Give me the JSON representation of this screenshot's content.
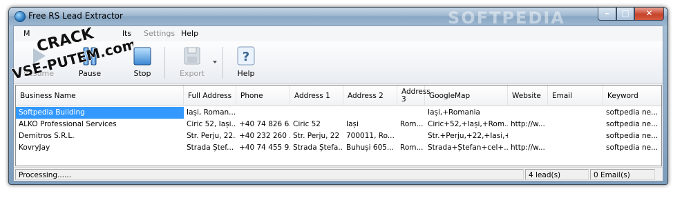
{
  "window": {
    "title": "Free RS Lead Extractor",
    "watermark": "SOFTPEDIA",
    "controls": {
      "minimize": "–",
      "maximize": "□",
      "close": "✕"
    }
  },
  "menu": {
    "items": [
      {
        "label": "M",
        "disabled": false
      },
      {
        "label": "lts",
        "disabled": false
      },
      {
        "label": "Settings",
        "disabled": true
      },
      {
        "label": "Help",
        "disabled": false
      }
    ]
  },
  "toolbar": {
    "resume": "Resume",
    "pause": "Pause",
    "stop": "Stop",
    "export": "Export",
    "help": "Help"
  },
  "grid": {
    "columns": [
      "Business Name",
      "Full Address",
      "Phone",
      "Address 1",
      "Address 2",
      "Address 3",
      "GoogleMap",
      "Website",
      "Email",
      "Keyword"
    ],
    "rows": [
      [
        "Softpedia Building",
        "Iași, Roman...",
        "",
        "",
        "",
        "",
        "Iași,+Romania",
        "",
        "",
        "softpedia ne..."
      ],
      [
        "ALKO Professional Services",
        "Ciric 52, Iași...",
        "+40 74 826 6...",
        "Ciric 52",
        "Iași",
        "Rom...",
        "Ciric+52,+Iași,+Rom...",
        "http://w...",
        "",
        "softpedia ne..."
      ],
      [
        "Demitros S.R.L.",
        "Str. Perju, 22...",
        "+40 232 260 ...",
        "Str. Perju,  22",
        "700011,  Ro...",
        "",
        "Str.+Perju,+22,+Iasi,+...",
        "",
        "",
        "softpedia ne..."
      ],
      [
        "KovryJay",
        "Strada Ștef...",
        "+40 74 455 9...",
        "Strada Ștefa...",
        "Buhuși 605...",
        "Rom...",
        "Strada+Ștefan+cel+...",
        "http://w...",
        "",
        "softpedia ne..."
      ]
    ]
  },
  "status": {
    "message": "Processing......",
    "leads": "4 lead(s)",
    "emails": "0 Email(s)"
  },
  "overlay": {
    "line1": "CRACK",
    "line2": "VSE-PUTEM.com"
  }
}
